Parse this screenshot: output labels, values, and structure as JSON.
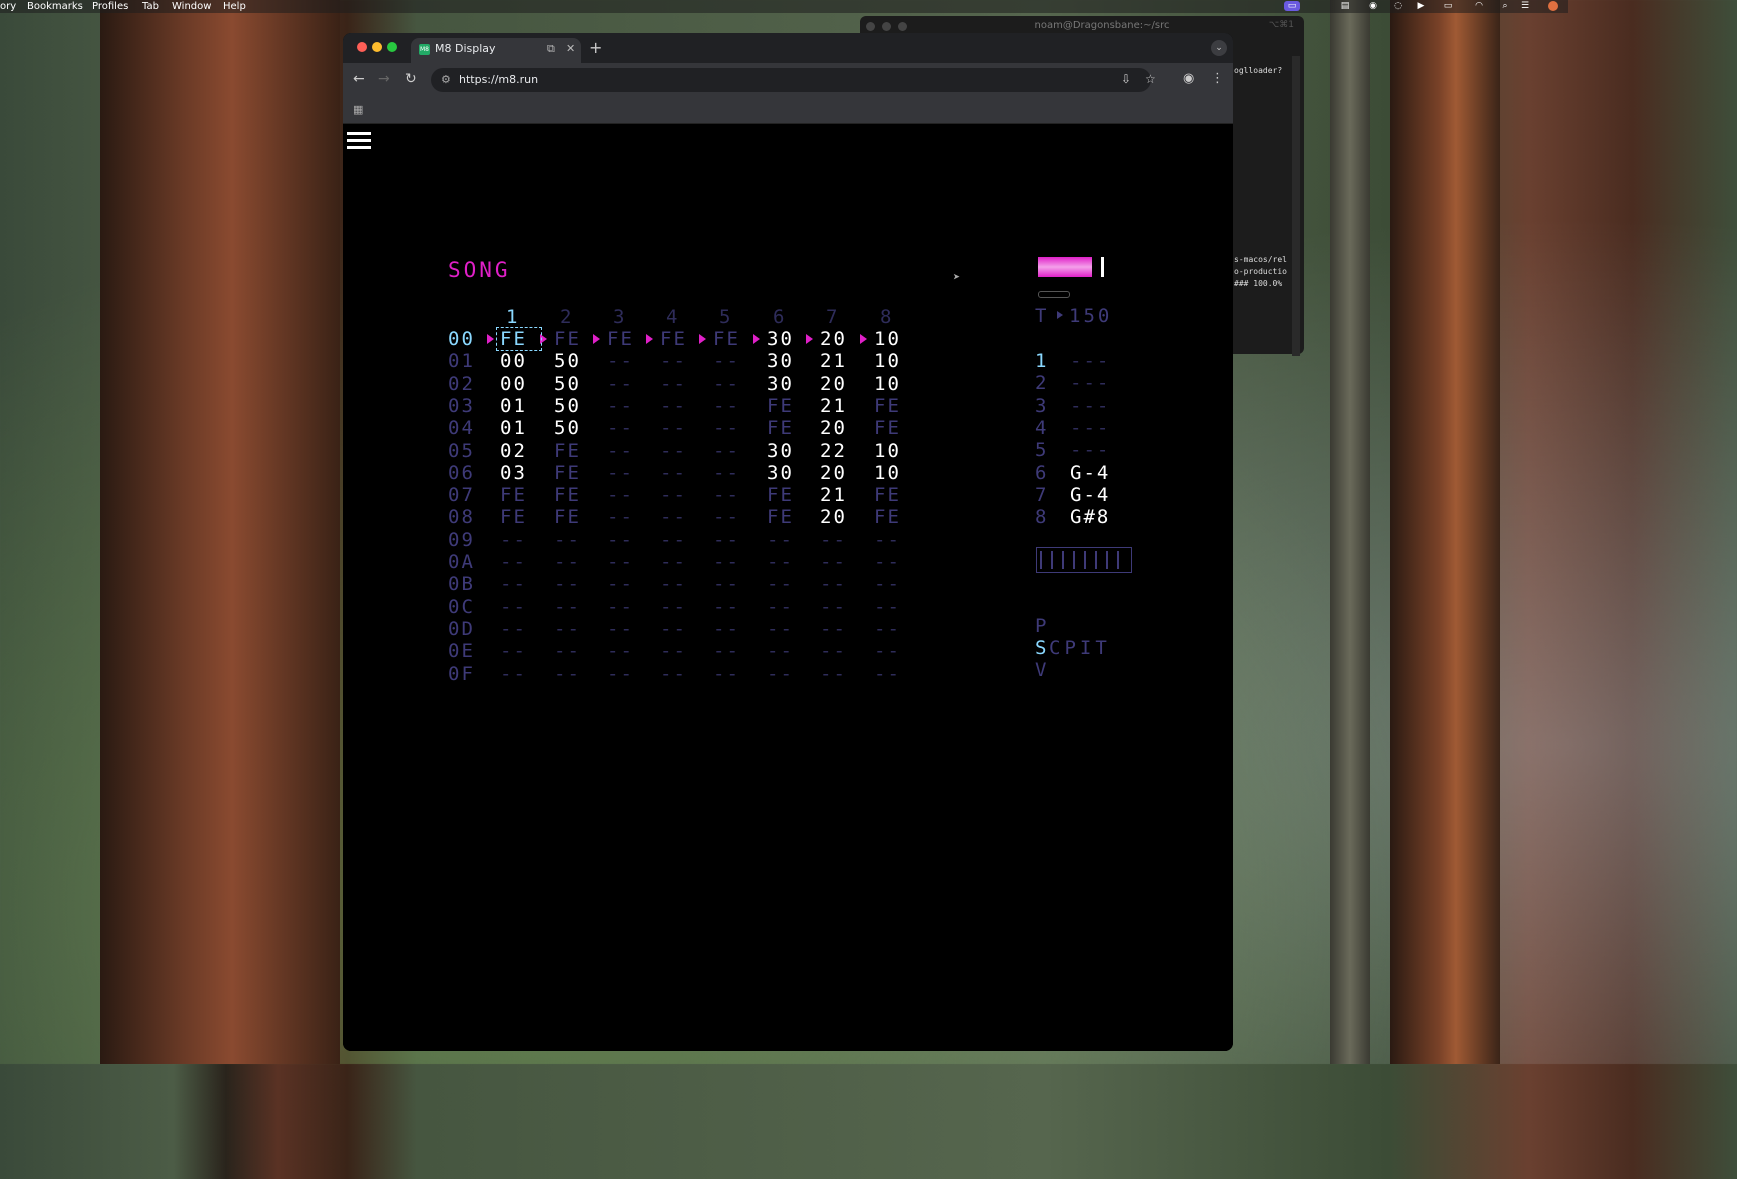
{
  "menubar": {
    "items": [
      "ory",
      "Bookmarks",
      "Profiles",
      "Tab",
      "Window",
      "Help"
    ]
  },
  "terminal": {
    "title": "noam@Dragonsbane:~/src",
    "shortcut": "⌥⌘1",
    "lines": [
      "oglloader?",
      "s-macos/rel",
      "o-productio",
      "### 100.0%"
    ]
  },
  "browser": {
    "tab_title": "M8 Display",
    "favicon_text": "M8",
    "url": "https://m8.run"
  },
  "m8": {
    "screen_title": "SONG",
    "track_headers": [
      "1",
      "2",
      "3",
      "4",
      "5",
      "6",
      "7",
      "8"
    ],
    "rows": [
      {
        "num": "00",
        "cells": [
          "FE",
          "FE",
          "FE",
          "FE",
          "FE",
          "30",
          "20",
          "10"
        ]
      },
      {
        "num": "01",
        "cells": [
          "00",
          "50",
          "--",
          "--",
          "--",
          "30",
          "21",
          "10"
        ]
      },
      {
        "num": "02",
        "cells": [
          "00",
          "50",
          "--",
          "--",
          "--",
          "30",
          "20",
          "10"
        ]
      },
      {
        "num": "03",
        "cells": [
          "01",
          "50",
          "--",
          "--",
          "--",
          "FE",
          "21",
          "FE"
        ]
      },
      {
        "num": "04",
        "cells": [
          "01",
          "50",
          "--",
          "--",
          "--",
          "FE",
          "20",
          "FE"
        ]
      },
      {
        "num": "05",
        "cells": [
          "02",
          "FE",
          "--",
          "--",
          "--",
          "30",
          "22",
          "10"
        ]
      },
      {
        "num": "06",
        "cells": [
          "03",
          "FE",
          "--",
          "--",
          "--",
          "30",
          "20",
          "10"
        ]
      },
      {
        "num": "07",
        "cells": [
          "FE",
          "FE",
          "--",
          "--",
          "--",
          "FE",
          "21",
          "FE"
        ]
      },
      {
        "num": "08",
        "cells": [
          "FE",
          "FE",
          "--",
          "--",
          "--",
          "FE",
          "20",
          "FE"
        ]
      },
      {
        "num": "09",
        "cells": [
          "--",
          "--",
          "--",
          "--",
          "--",
          "--",
          "--",
          "--"
        ]
      },
      {
        "num": "0A",
        "cells": [
          "--",
          "--",
          "--",
          "--",
          "--",
          "--",
          "--",
          "--"
        ]
      },
      {
        "num": "0B",
        "cells": [
          "--",
          "--",
          "--",
          "--",
          "--",
          "--",
          "--",
          "--"
        ]
      },
      {
        "num": "0C",
        "cells": [
          "--",
          "--",
          "--",
          "--",
          "--",
          "--",
          "--",
          "--"
        ]
      },
      {
        "num": "0D",
        "cells": [
          "--",
          "--",
          "--",
          "--",
          "--",
          "--",
          "--",
          "--"
        ]
      },
      {
        "num": "0E",
        "cells": [
          "--",
          "--",
          "--",
          "--",
          "--",
          "--",
          "--",
          "--"
        ]
      },
      {
        "num": "0F",
        "cells": [
          "--",
          "--",
          "--",
          "--",
          "--",
          "--",
          "--",
          "--"
        ]
      }
    ],
    "bright_cells": [
      [
        0,
        5
      ],
      [
        0,
        6
      ],
      [
        0,
        7
      ],
      [
        1,
        0
      ],
      [
        1,
        1
      ],
      [
        1,
        5
      ],
      [
        1,
        6
      ],
      [
        1,
        7
      ],
      [
        2,
        0
      ],
      [
        2,
        1
      ],
      [
        2,
        5
      ],
      [
        2,
        6
      ],
      [
        2,
        7
      ],
      [
        3,
        0
      ],
      [
        3,
        1
      ],
      [
        3,
        6
      ],
      [
        4,
        0
      ],
      [
        4,
        1
      ],
      [
        4,
        6
      ],
      [
        5,
        0
      ],
      [
        5,
        5
      ],
      [
        5,
        6
      ],
      [
        5,
        7
      ],
      [
        6,
        0
      ],
      [
        6,
        5
      ],
      [
        6,
        6
      ],
      [
        6,
        7
      ],
      [
        7,
        6
      ],
      [
        8,
        6
      ]
    ],
    "tempo_label": "T",
    "tempo_value": "150",
    "track_status": [
      {
        "num": "1",
        "note": "---"
      },
      {
        "num": "2",
        "note": "---"
      },
      {
        "num": "3",
        "note": "---"
      },
      {
        "num": "4",
        "note": "---"
      },
      {
        "num": "5",
        "note": "---"
      },
      {
        "num": "6",
        "note": "G-4"
      },
      {
        "num": "7",
        "note": "G-4"
      },
      {
        "num": "8",
        "note": "G#8"
      }
    ],
    "nav_map": {
      "top": "P",
      "middle_active": "S",
      "middle_rest": "CPIT",
      "bottom": "V"
    },
    "colors": {
      "title": "#e020c8",
      "dim": "#3e3a78",
      "value": "#ffffff",
      "cursor": "#8ad8ff"
    }
  }
}
